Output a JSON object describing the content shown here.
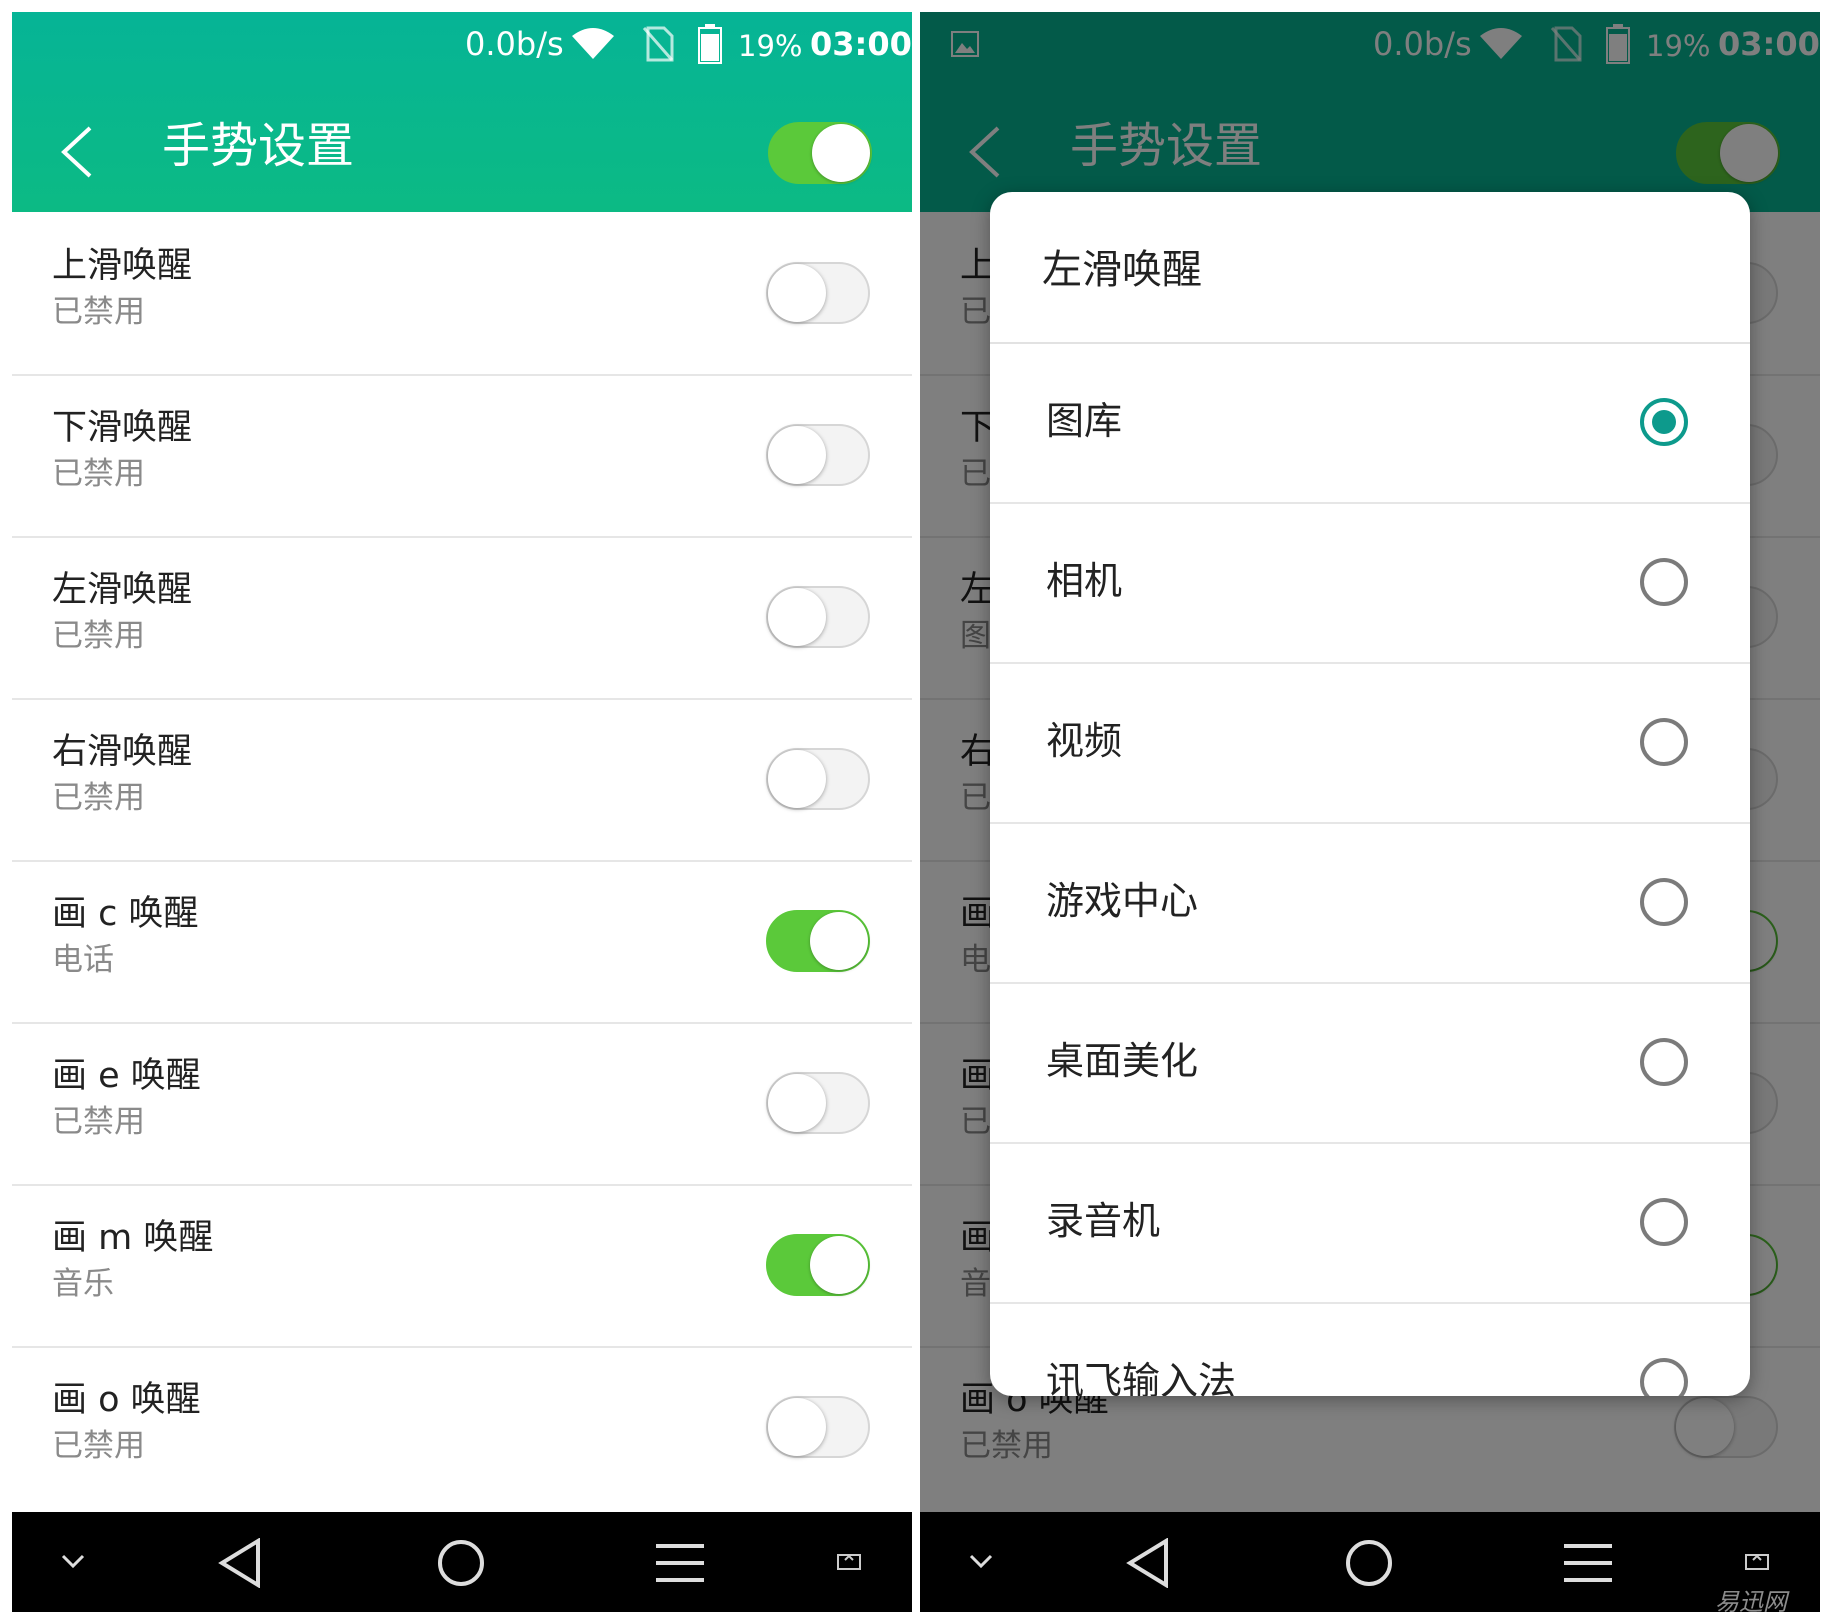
{
  "status_bar": {
    "speed": "0.0b/s",
    "battery_percent": "19%",
    "time": "03:00",
    "icons": [
      "wifi-icon",
      "no-sim-icon",
      "battery-icon"
    ]
  },
  "header": {
    "title": "手势设置",
    "master_switch_on": true
  },
  "gestures": [
    {
      "title": "上滑唤醒",
      "status": "已禁用",
      "enabled": false
    },
    {
      "title": "下滑唤醒",
      "status": "已禁用",
      "enabled": false
    },
    {
      "title": "左滑唤醒",
      "status": "已禁用",
      "enabled": false
    },
    {
      "title": "右滑唤醒",
      "status": "已禁用",
      "enabled": false
    },
    {
      "title": "画 c 唤醒",
      "status": "电话",
      "enabled": true
    },
    {
      "title": "画 e 唤醒",
      "status": "已禁用",
      "enabled": false
    },
    {
      "title": "画 m 唤醒",
      "status": "音乐",
      "enabled": true
    },
    {
      "title": "画 o 唤醒",
      "status": "已禁用",
      "enabled": false
    }
  ],
  "right_background_rows": [
    {
      "title_char": "上",
      "sub_char": "已"
    },
    {
      "title_char": "下",
      "sub_char": "已"
    },
    {
      "title_char": "左",
      "sub_char": "图"
    },
    {
      "title_char": "右",
      "sub_char": "已"
    },
    {
      "title_char": "画",
      "sub_char": "电"
    },
    {
      "title_char": "画",
      "sub_char": "已"
    },
    {
      "title_char": "画",
      "sub_char": "音"
    },
    {
      "title_char": "画 o 唤醒",
      "sub_char": "已禁用"
    }
  ],
  "dialog": {
    "title": "左滑唤醒",
    "options": [
      {
        "label": "图库",
        "selected": true
      },
      {
        "label": "相机",
        "selected": false
      },
      {
        "label": "视频",
        "selected": false
      },
      {
        "label": "游戏中心",
        "selected": false
      },
      {
        "label": "桌面美化",
        "selected": false
      },
      {
        "label": "录音机",
        "selected": false
      },
      {
        "label": "讯飞输入法",
        "selected": false
      }
    ]
  },
  "nav_bar": {
    "buttons": [
      "collapse-icon",
      "back-icon",
      "home-icon",
      "menu-icon",
      "screenshot-icon"
    ]
  },
  "colors": {
    "header": "#07b592",
    "header_dim": "#044d3f",
    "switch_on": "#5bc93a",
    "radio_selected": "#0d9a8c"
  },
  "watermark": "易迅网"
}
